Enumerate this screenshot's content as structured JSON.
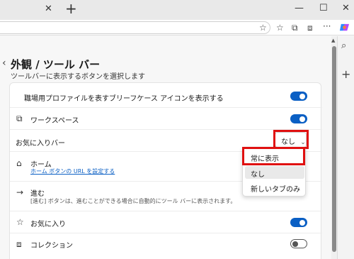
{
  "tabbar": {
    "close_glyph": "✕",
    "new_tab_glyph": "+",
    "minimize_glyph": "—",
    "maximize_glyph": "☐",
    "close_window_glyph": "✕"
  },
  "toolbar": {
    "icons": [
      "star-icon",
      "favorites-icon",
      "extensions-icon",
      "collections-icon",
      "more-icon",
      "copilot-icon"
    ],
    "star_glyph": "☆",
    "favorites_glyph": "☆",
    "extensions_glyph": "⧉",
    "collections_glyph": "⧈",
    "more_glyph": "···",
    "copilot_color": "#7a5cff"
  },
  "page": {
    "back_glyph": "‹",
    "title": "外観 / ツール バー",
    "subtitle": "ツールバーに表示するボタンを選択します"
  },
  "rows": {
    "work_profile": {
      "label": "職場用プロファイルを表すブリーフケース アイコンを表示する",
      "toggle": "on"
    },
    "workspaces": {
      "label": "ワークスペース",
      "toggle": "on",
      "icon": "workspace-icon",
      "glyph": "⧉"
    },
    "favorites_bar": {
      "label": "お気に入りバー",
      "value": "なし",
      "chevron": "⌄"
    },
    "home": {
      "label": "ホーム",
      "link": "ホーム ボタンの URL を設定する",
      "icon": "home-icon",
      "glyph": "⌂"
    },
    "forward": {
      "label": "進む",
      "desc": "[進む] ボタンは、進むことができる場合に自動的にツール バーに表示されます。",
      "icon": "forward-arrow-icon",
      "glyph": "→"
    },
    "favorites": {
      "label": "お気に入り",
      "toggle": "on",
      "icon": "favorites-star-icon",
      "glyph": "☆"
    },
    "collections": {
      "label": "コレクション",
      "toggle": "off",
      "icon": "collections-icon",
      "glyph": "⧈"
    }
  },
  "dropdown_menu": {
    "options": [
      "常に表示",
      "なし",
      "新しいタブのみ"
    ],
    "selected": "なし"
  },
  "sidepane": {
    "search_glyph": "⌕",
    "add_glyph": "+"
  },
  "colors": {
    "accent": "#0a5fc4",
    "highlight": "#e01010"
  }
}
